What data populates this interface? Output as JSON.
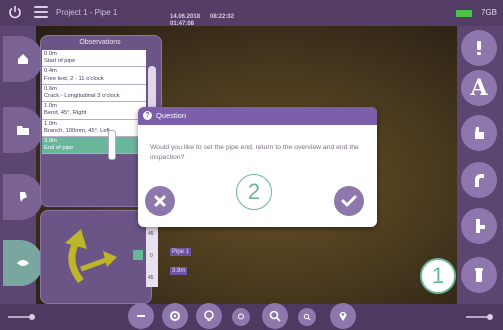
{
  "topbar": {
    "project_title": "Project 1 - Pipe 1",
    "storage": "7GB",
    "date": "14.06.2018",
    "time": "08:22:02",
    "distance": "01:47:08"
  },
  "observations": {
    "title": "Observations",
    "items": [
      {
        "distance": "0.0m",
        "text": "Start of pipe"
      },
      {
        "distance": "0.4m",
        "text": "Free text, 2 - 11 o'clock"
      },
      {
        "distance": "0.6m",
        "text": "Crack - Longitudinal 3 o'clock"
      },
      {
        "distance": "1.0m",
        "text": "Bend, 45°, Right"
      },
      {
        "distance": "1.0m",
        "text": "Branch, 100mm, 45°, Left"
      },
      {
        "distance": "3.9m",
        "text": "End of pipe"
      }
    ]
  },
  "ruler": {
    "labels": [
      "45",
      "0",
      "45"
    ]
  },
  "pipe_tags": {
    "pipe": "Pipe 1",
    "meters": "3.9m"
  },
  "dialog": {
    "title": "Question",
    "message": "Would you like to set the pipe end, return to the overview and end the inspection?"
  },
  "badges": {
    "one": "1",
    "two": "2"
  },
  "colors": {
    "accent": "#7b5fab",
    "teal": "#6ab69a",
    "sidebar": "#5b4672"
  },
  "icons": [
    "power-icon",
    "menu-icon",
    "home-icon",
    "folder-icon",
    "pin-icon",
    "exclamation-icon",
    "text-a-icon",
    "hand-icon",
    "bend-icon",
    "branch-icon",
    "end-icon",
    "settings-icon",
    "bulb-icon",
    "zoom-icon",
    "location-icon",
    "cancel-icon",
    "check-icon"
  ]
}
